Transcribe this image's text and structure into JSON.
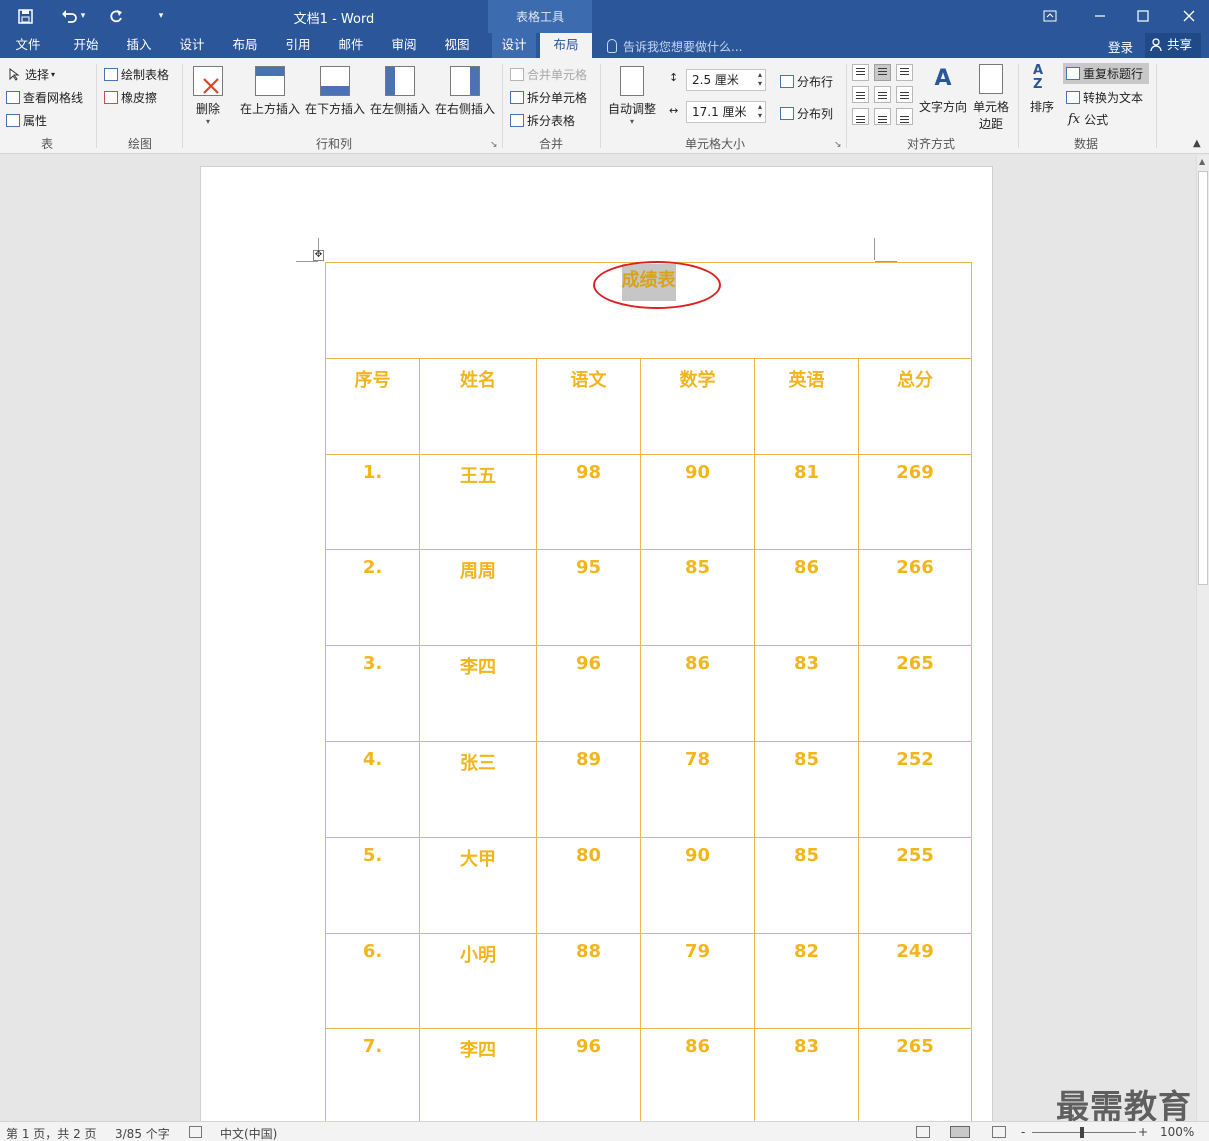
{
  "titlebar": {
    "doc_title": "文档1 - Word",
    "context_tools": "表格工具",
    "quick_access": {
      "undo_dropdown": "▾",
      "customize": "▾"
    }
  },
  "tabs": [
    {
      "label": "文件"
    },
    {
      "label": "开始"
    },
    {
      "label": "插入"
    },
    {
      "label": "设计"
    },
    {
      "label": "布局"
    },
    {
      "label": "引用"
    },
    {
      "label": "邮件"
    },
    {
      "label": "审阅"
    },
    {
      "label": "视图"
    },
    {
      "label": "设计"
    },
    {
      "label": "布局"
    }
  ],
  "tellme": "告诉我您想要做什么...",
  "account": {
    "login": "登录",
    "share": "共享"
  },
  "ribbon": {
    "table": {
      "select": "选择",
      "view_gridlines": "查看网格线",
      "properties": "属性",
      "label": "表"
    },
    "draw": {
      "draw_table": "绘制表格",
      "eraser": "橡皮擦",
      "label": "绘图"
    },
    "rows_cols": {
      "delete": "删除",
      "insert_above": "在上方插入",
      "insert_below": "在下方插入",
      "insert_left": "在左侧插入",
      "insert_right": "在右侧插入",
      "label": "行和列"
    },
    "merge": {
      "merge_cells": "合并单元格",
      "split_cells": "拆分单元格",
      "split_table": "拆分表格",
      "label": "合并"
    },
    "cell_size": {
      "autofit": "自动调整",
      "height": "2.5 厘米",
      "width": "17.1 厘米",
      "distribute_rows": "分布行",
      "distribute_cols": "分布列",
      "label": "单元格大小"
    },
    "alignment": {
      "text_direction": "文字方向",
      "cell_margins_1": "单元格",
      "cell_margins_2": "边距",
      "label": "对齐方式"
    },
    "data": {
      "sort": "排序",
      "repeat_header": "重复标题行",
      "convert_text": "转换为文本",
      "formula": "公式",
      "label": "数据"
    }
  },
  "table": {
    "title": "成绩表",
    "headers": [
      "序号",
      "姓名",
      "语文",
      "数学",
      "英语",
      "总分"
    ],
    "rows": [
      [
        "1.",
        "王五",
        "98",
        "90",
        "81",
        "269"
      ],
      [
        "2.",
        "周周",
        "95",
        "85",
        "86",
        "266"
      ],
      [
        "3.",
        "李四",
        "96",
        "86",
        "83",
        "265"
      ],
      [
        "4.",
        "张三",
        "89",
        "78",
        "85",
        "252"
      ],
      [
        "5.",
        "大甲",
        "80",
        "90",
        "85",
        "255"
      ],
      [
        "6.",
        "小明",
        "88",
        "79",
        "82",
        "249"
      ],
      [
        "7.",
        "李四",
        "96",
        "86",
        "83",
        "265"
      ]
    ]
  },
  "status": {
    "page": "第 1 页，共 2 页",
    "words": "3/85 个字",
    "language": "中文(中国)",
    "zoom_minus": "-",
    "zoom_plus": "+",
    "zoom": "100%"
  },
  "watermark": "最需教育",
  "colors": {
    "title_bar": "#2b579a",
    "table_border": "#e9b84a",
    "cell_text": "#f3b51c",
    "highlight_oval": "#e02020"
  }
}
